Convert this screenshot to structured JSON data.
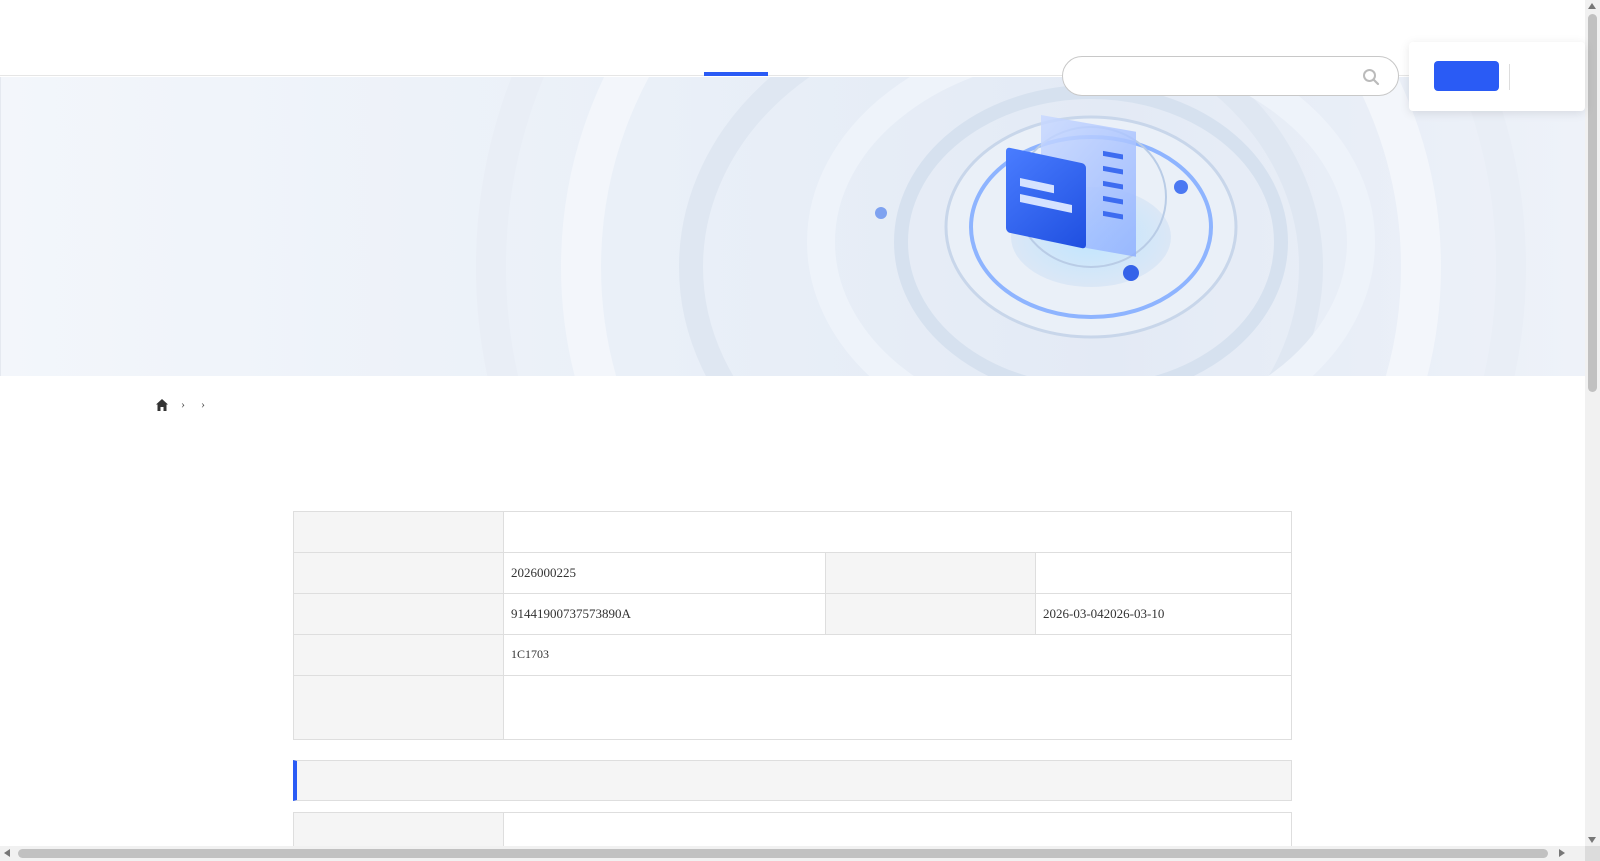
{
  "header": {
    "logo_line1": "",
    "logo_line2": "",
    "nav": [
      {
        "label": ""
      },
      {
        "label": ""
      },
      {
        "label": ""
      },
      {
        "label": ""
      },
      {
        "label": ""
      },
      {
        "label": ""
      }
    ],
    "active_nav_index": 3,
    "nav_sub": "",
    "search": {
      "placeholder": ""
    },
    "login_label": "",
    "user_link1": "",
    "user_link2": ""
  },
  "banner": {
    "title_line1": "",
    "title_line2": ""
  },
  "breadcrumb": {
    "home": "",
    "level1": "",
    "current": ""
  },
  "page_title": "",
  "info": {
    "row1": {
      "label": "",
      "value": ""
    },
    "row2": {
      "label_a": "",
      "value_a": "2026000225",
      "label_b": "",
      "value_b": ""
    },
    "row3": {
      "label_a": "",
      "value_a": "91441900737573890A",
      "label_b": "",
      "value_b": "2026-03-042026-03-10"
    },
    "row4": {
      "label": "",
      "value": "1C1703"
    },
    "row5": {
      "label": "",
      "value": ""
    }
  },
  "section2": {
    "title": "",
    "row1": {
      "label": "",
      "value": ""
    }
  },
  "colors": {
    "accent": "#2a5bf5",
    "label_bg": "#f5f5f5",
    "border": "#dedede"
  }
}
